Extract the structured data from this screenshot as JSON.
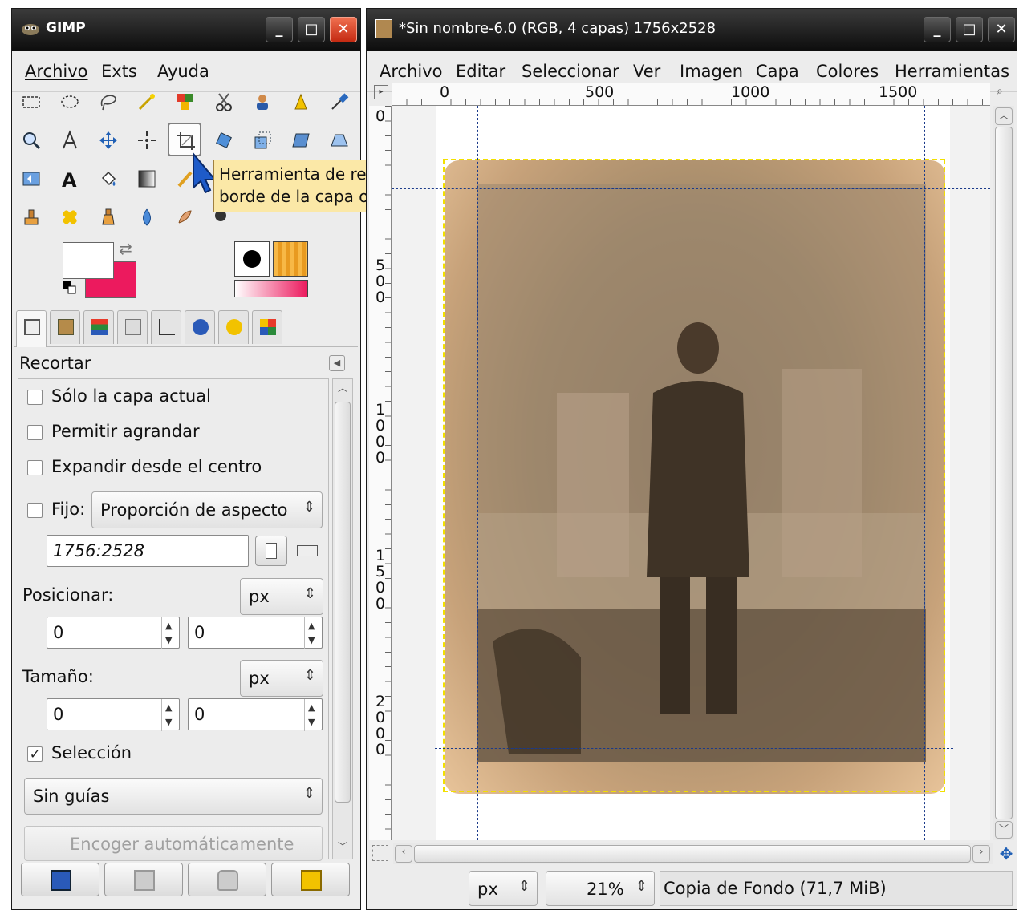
{
  "toolbox": {
    "title": "GIMP",
    "menu": [
      "Archivo",
      "Exts",
      "Ayuda"
    ],
    "tooltip_line1": "Herramienta de recorte: quitar zonas del",
    "tooltip_line2": "borde de la capa o imagen  (Mayús.+C)",
    "colors": {
      "foreground": "#ffffff",
      "background": "#ec1a5e"
    }
  },
  "tool_options": {
    "title": "Recortar",
    "only_current_layer": "Sólo la capa actual",
    "allow_growing": "Permitir agrandar",
    "expand_from_center": "Expandir desde el centro",
    "fixed_label": "Fijo:",
    "fixed_mode": "Proporción de aspecto",
    "ratio_value": "1756:2528",
    "position_label": "Posicionar:",
    "position_unit": "px",
    "position_x": "0",
    "position_y": "0",
    "size_label": "Tamaño:",
    "size_unit": "px",
    "size_w": "0",
    "size_h": "0",
    "selection_label": "Selección",
    "selection_checked": true,
    "guides": "Sin guías",
    "auto_shrink": "Encoger automáticamente"
  },
  "image_window": {
    "title": "*Sin nombre-6.0 (RGB, 4 capas) 1756x2528",
    "menu": [
      "Archivo",
      "Editar",
      "Seleccionar",
      "Ver",
      "Imagen",
      "Capa",
      "Colores",
      "Herramientas"
    ],
    "ruler_h": [
      "0",
      "500",
      "1000",
      "1500"
    ],
    "ruler_v": [
      "0",
      "500",
      "1000",
      "1500",
      "2000"
    ],
    "status_unit": "px",
    "zoom": "21%",
    "layer_status": "Copia de Fondo (71,7 MiB)"
  }
}
